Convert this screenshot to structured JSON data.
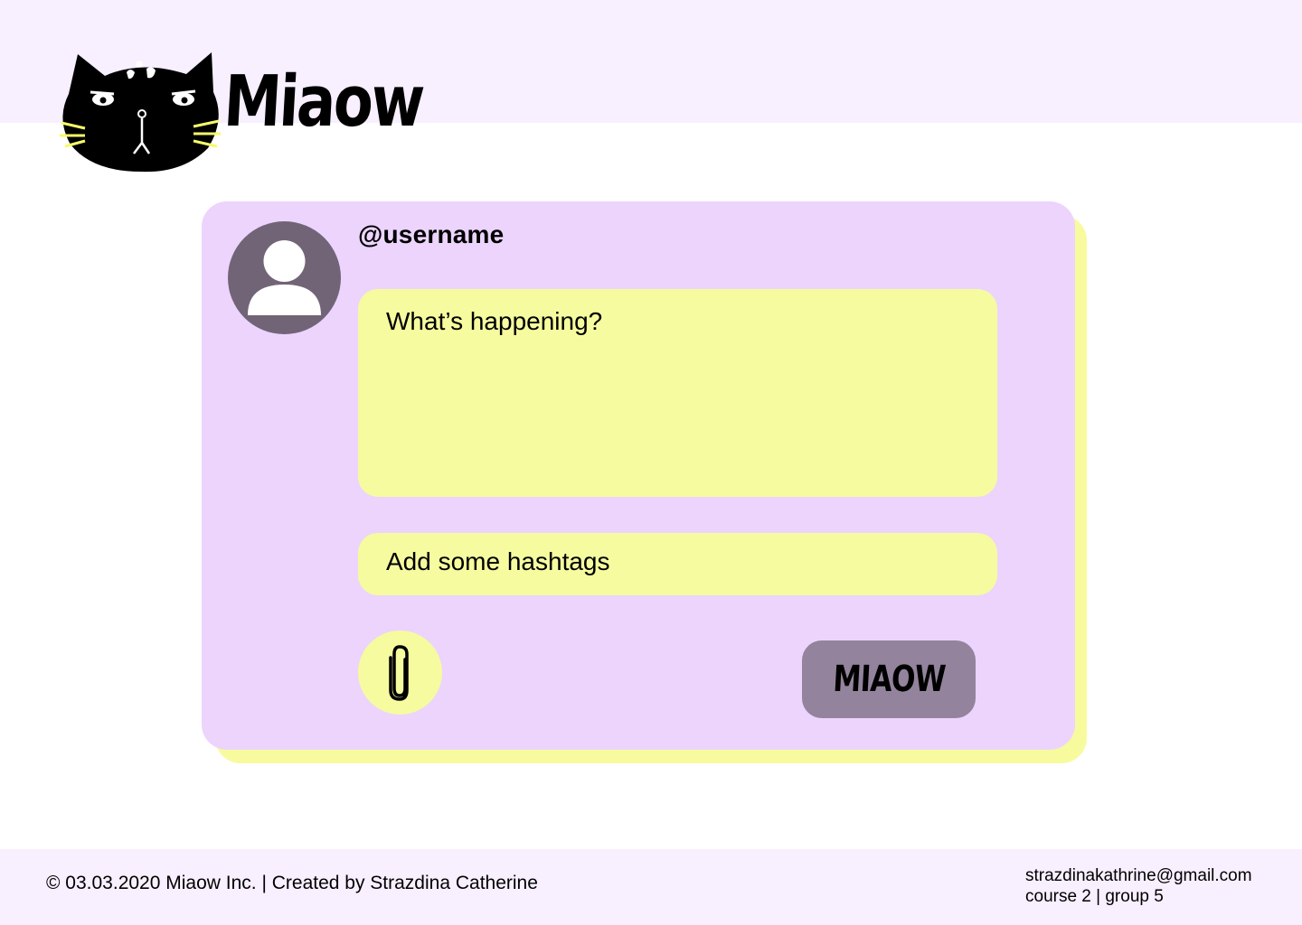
{
  "brand": {
    "name": "Miaow",
    "logo_icon": "cat-face-icon"
  },
  "composer": {
    "username": "@username",
    "avatar_icon": "user-avatar-icon",
    "post_placeholder": "What’s happening?",
    "hashtag_placeholder": "Add some hashtags",
    "attach_icon": "paperclip-icon",
    "submit_label": "MIAOW"
  },
  "footer": {
    "copyright": "© 03.03.2020 Miaow Inc. | Created by Strazdina Catherine",
    "email": "strazdinakathrine@gmail.com",
    "course": "course 2 | group 5"
  },
  "colors": {
    "band": "#f8efff",
    "card": "#ecd4fd",
    "card_shadow": "#f7fb9e",
    "field": "#f6fb9f",
    "avatar": "#726477",
    "button": "#94839c"
  }
}
